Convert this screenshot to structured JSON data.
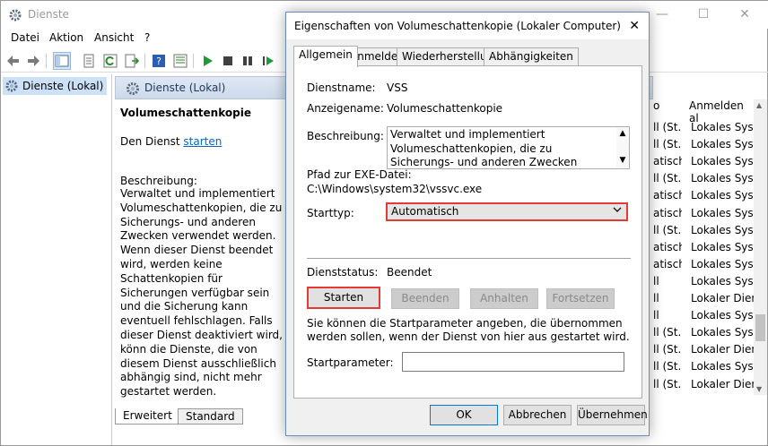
{
  "window": {
    "title": "Dienste",
    "min": "—",
    "max": "☐",
    "close": "✕"
  },
  "menu": [
    "Datei",
    "Aktion",
    "Ansicht",
    "?"
  ],
  "tree": {
    "root": "Dienste (Lokal)"
  },
  "detail": {
    "header": "Dienste (Lokal)",
    "service_name": "Volumeschattenkopie",
    "start_prefix": "Den Dienst ",
    "start_link": "starten",
    "desc_label": "Beschreibung:",
    "description": "Verwaltet und implementiert Volumeschattenkopien, die zu Sicherungs- und anderen Zwecken verwendet werden. Wenn dieser Dienst beendet wird, werden keine Schattenkopien für Sicherungen verfügbar sein und die Sicherung kann eventuell fehlschlagen. Falls dieser Dienst deaktiviert wird, könn die Dienste, die von diesem Dienst ausschließlich abhängig sind, nicht mehr gestartet werden."
  },
  "bottom_tabs": [
    "Erweitert",
    "Standard"
  ],
  "right_list": {
    "header_startup": "o",
    "header_login": "Anmelden al",
    "rows": [
      {
        "start": "ll (St...",
        "login": "Lokales Syste"
      },
      {
        "start": "ll (St...",
        "login": "Lokales Syste"
      },
      {
        "start": "atisch",
        "login": "Lokales Syste"
      },
      {
        "start": "ll (St...",
        "login": "Lokales Syste"
      },
      {
        "start": "atisch",
        "login": "Lokales Syste"
      },
      {
        "start": "atisch",
        "login": "Lokales Syste"
      },
      {
        "start": "ll (St...",
        "login": "Lokales Syste"
      },
      {
        "start": "atisch",
        "login": "Lokales Syste"
      },
      {
        "start": "atisch",
        "login": "Lokales Syste"
      },
      {
        "start": "ll",
        "login": "Lokales Syste"
      },
      {
        "start": "ll",
        "login": "Lokaler Dien"
      },
      {
        "start": "ll",
        "login": "Lokales Syste"
      },
      {
        "start": "ll (St...",
        "login": "Lokales Syste"
      },
      {
        "start": "ll (St...",
        "login": "Lokaler Dien"
      },
      {
        "start": "ll (St...",
        "login": "Lokales Syste"
      },
      {
        "start": "ll (St...",
        "login": "Lokaler Dien"
      }
    ]
  },
  "dialog": {
    "title": "Eigenschaften von Volumeschattenkopie (Lokaler Computer)",
    "close": "✕",
    "tabs": [
      "Allgemein",
      "Anmelden",
      "Wiederherstellung",
      "Abhängigkeiten"
    ],
    "service_name_label": "Dienstname:",
    "service_name": "VSS",
    "display_name_label": "Anzeigename:",
    "display_name": "Volumeschattenkopie",
    "desc_label": "Beschreibung:",
    "description": "Verwaltet und implementiert Volumeschattenkopien, die zu Sicherungs- und anderen Zwecken verwendet werden. Wenn dieser Dienst beendet",
    "path_label": "Pfad zur EXE-Datei:",
    "path": "C:\\Windows\\system32\\vssvc.exe",
    "starttype_label": "Starttyp:",
    "starttype_value": "Automatisch",
    "status_label": "Dienststatus:",
    "status_value": "Beendet",
    "buttons": {
      "start": "Starten",
      "stop": "Beenden",
      "pause": "Anhalten",
      "resume": "Fortsetzen"
    },
    "hint": "Sie können die Startparameter angeben, die übernommen werden sollen, wenn der Dienst von hier aus gestartet wird.",
    "param_label": "Startparameter:",
    "param_value": "",
    "ok": "OK",
    "cancel": "Abbrechen",
    "apply": "Übernehmen"
  }
}
